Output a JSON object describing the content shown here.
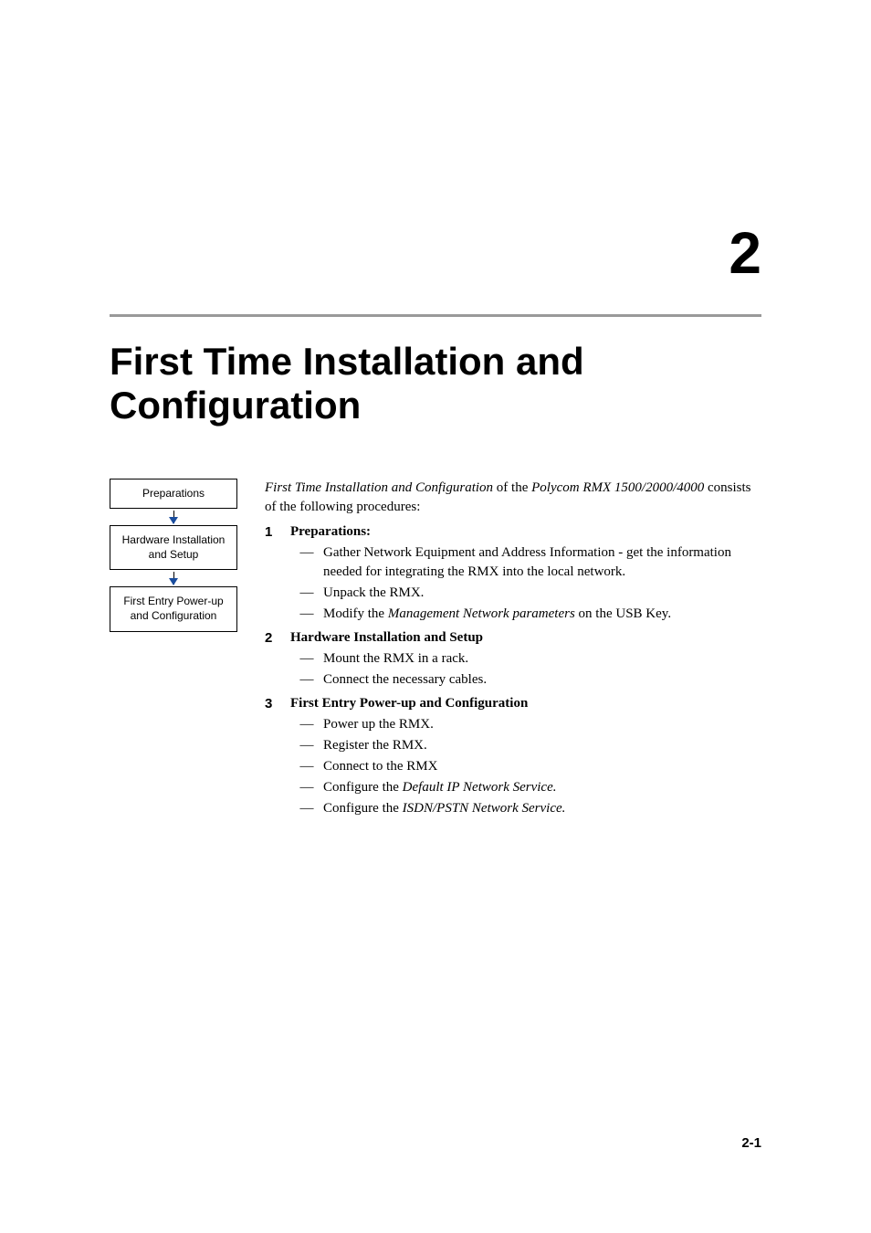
{
  "chapter": {
    "number": "2",
    "title": "First Time Installation and Configuration"
  },
  "flowchart": {
    "box1": "Preparations",
    "box2": "Hardware Installation and Setup",
    "box3": "First Entry Power-up and Configuration"
  },
  "intro": {
    "part1_italic": "First Time Installation and Configuration",
    "part2": " of the ",
    "part3_italic": "Polycom RMX 1500/2000/4000",
    "part4": " consists of the following procedures:"
  },
  "steps": [
    {
      "num": "1",
      "title": "Preparations:",
      "items": [
        {
          "text": "Gather Network Equipment and Address Information - get the information needed for integrating the RMX into the local network."
        },
        {
          "text": "Unpack the RMX."
        },
        {
          "pre": "Modify the ",
          "italic": "Management Network parameters",
          "post": " on the USB Key."
        }
      ]
    },
    {
      "num": "2",
      "title": "Hardware Installation and Setup",
      "items": [
        {
          "text": "Mount the RMX in a rack."
        },
        {
          "text": "Connect the necessary cables."
        }
      ]
    },
    {
      "num": "3",
      "title": "First Entry Power-up and Configuration",
      "items": [
        {
          "text": "Power up the RMX."
        },
        {
          "text": "Register the RMX."
        },
        {
          "text": "Connect to the RMX"
        },
        {
          "pre": "Configure the ",
          "italic": "Default IP Network Service."
        },
        {
          "pre": "Configure the ",
          "italic": "ISDN/PSTN Network Service."
        }
      ]
    }
  ],
  "pageNumber": "2-1"
}
